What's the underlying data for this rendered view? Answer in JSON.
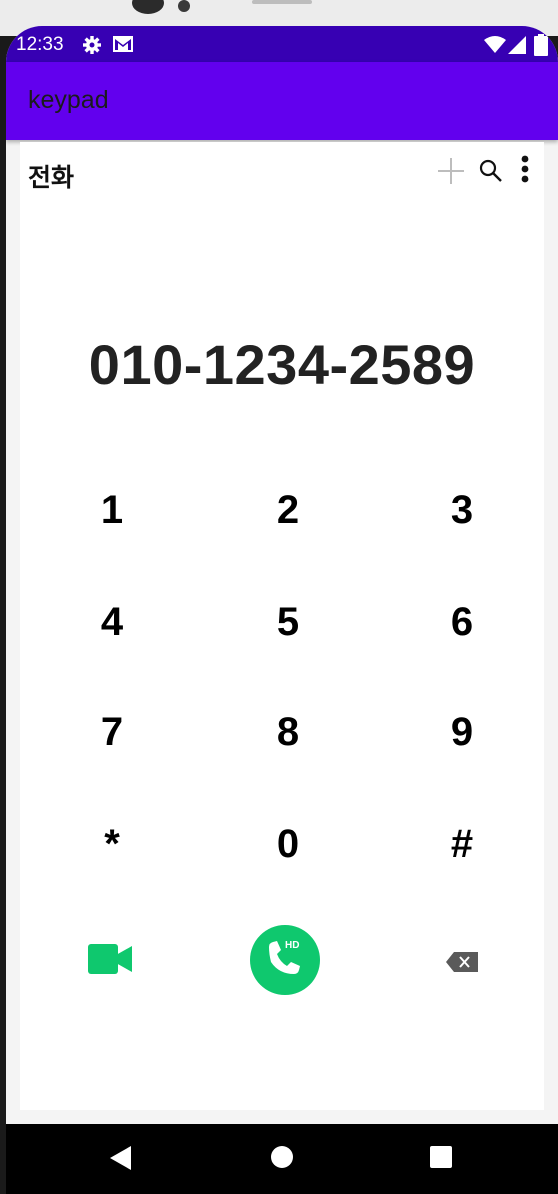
{
  "status_bar": {
    "time": "12:33",
    "icons": [
      "gear-icon",
      "gmail-icon",
      "wifi-icon",
      "signal-icon",
      "battery-icon"
    ]
  },
  "app_bar": {
    "title": "keypad"
  },
  "dialer": {
    "section_title": "전화",
    "toolbar_icons": [
      "add-icon",
      "search-icon",
      "more-vert-icon"
    ],
    "phone_number": "010-1234-2589",
    "keys": [
      "1",
      "2",
      "3",
      "4",
      "5",
      "6",
      "7",
      "8",
      "9",
      "*",
      "0",
      "#"
    ],
    "call_badge": "HD",
    "actions": [
      "video-call-icon",
      "hd-call-icon",
      "backspace-icon"
    ]
  },
  "nav_bar": {
    "buttons": [
      "back-icon",
      "home-icon",
      "recents-icon"
    ]
  },
  "colors": {
    "status_bar": "#3700b3",
    "app_bar": "#6200ee",
    "call_green": "#0fc86e",
    "nav_bar": "#000000"
  }
}
